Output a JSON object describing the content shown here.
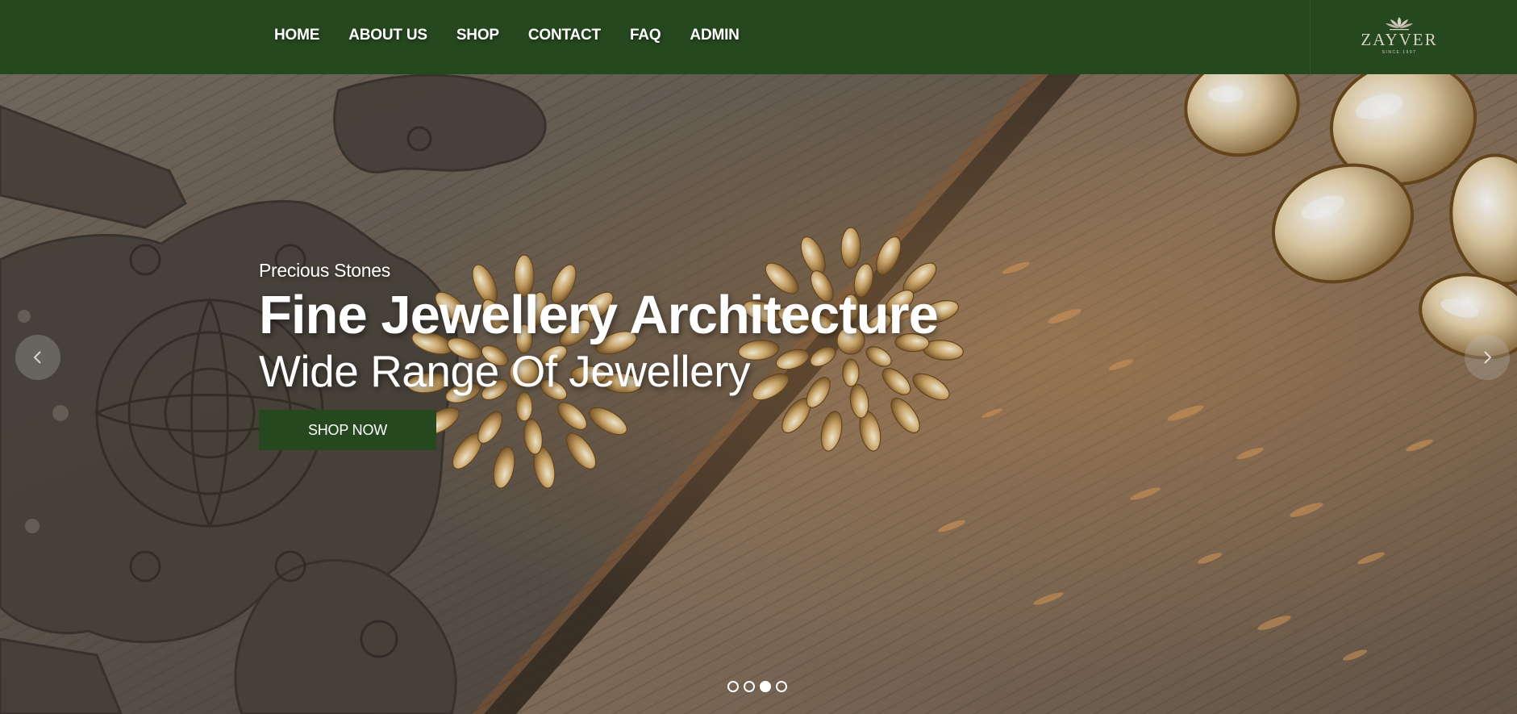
{
  "nav": {
    "items": [
      {
        "label": "HOME"
      },
      {
        "label": "ABOUT US"
      },
      {
        "label": "SHOP"
      },
      {
        "label": "CONTACT"
      },
      {
        "label": "FAQ"
      },
      {
        "label": "ADMIN"
      }
    ]
  },
  "logo": {
    "name": "ZAYVER",
    "tagline": "SINCE 1997"
  },
  "hero": {
    "eyebrow": "Precious Stones",
    "title": "Fine Jewellery Architecture",
    "subtitle": "Wide Range Of Jewellery",
    "cta_label": "SHOP NOW",
    "prev_icon": "chevron-left-icon",
    "next_icon": "chevron-right-icon",
    "slides_count": 4,
    "active_slide": 3
  },
  "colors": {
    "brand_green": "#26481f",
    "text_white": "#ffffff"
  }
}
